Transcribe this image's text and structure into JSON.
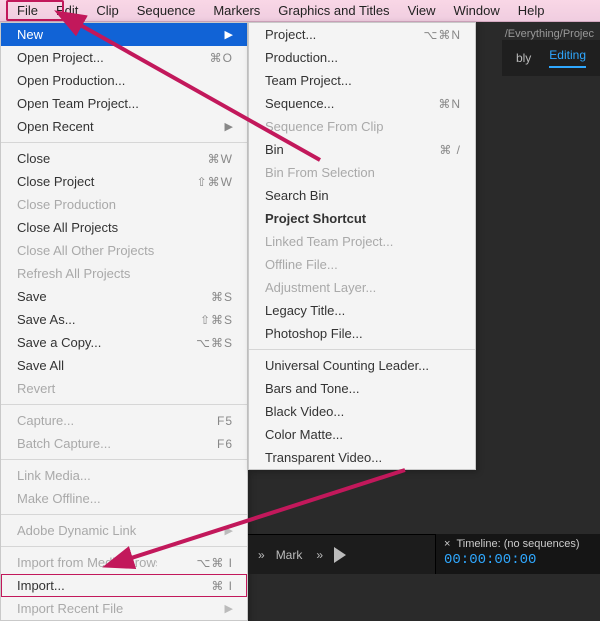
{
  "menubar": {
    "items": [
      "File",
      "Edit",
      "Clip",
      "Sequence",
      "Markers",
      "Graphics and Titles",
      "View",
      "Window",
      "Help"
    ]
  },
  "workspace": {
    "path_fragment": "/Everything/Projec",
    "tab_bly": "bly",
    "tab_editing": "Editing"
  },
  "file_menu": {
    "new": "New",
    "open_project": {
      "label": "Open Project...",
      "shortcut": "⌘O"
    },
    "open_production": "Open Production...",
    "open_team_project": "Open Team Project...",
    "open_recent": "Open Recent",
    "close": {
      "label": "Close",
      "shortcut": "⌘W"
    },
    "close_project": {
      "label": "Close Project",
      "shortcut": "⇧⌘W"
    },
    "close_production": "Close Production",
    "close_all_projects": "Close All Projects",
    "close_all_other": "Close All Other Projects",
    "refresh_all": "Refresh All Projects",
    "save": {
      "label": "Save",
      "shortcut": "⌘S"
    },
    "save_as": {
      "label": "Save As...",
      "shortcut": "⇧⌘S"
    },
    "save_copy": {
      "label": "Save a Copy...",
      "shortcut": "⌥⌘S"
    },
    "save_all": "Save All",
    "revert": "Revert",
    "capture": {
      "label": "Capture...",
      "shortcut": "F5"
    },
    "batch_capture": {
      "label": "Batch Capture...",
      "shortcut": "F6"
    },
    "link_media": "Link Media...",
    "make_offline": "Make Offline...",
    "adl": "Adobe Dynamic Link",
    "import_from_mb": {
      "label": "Import from Media Browser",
      "shortcut": "⌥⌘ I"
    },
    "import": {
      "label": "Import...",
      "shortcut": "⌘ I"
    },
    "import_recent": "Import Recent File"
  },
  "new_submenu": {
    "project": {
      "label": "Project...",
      "shortcut": "⌥⌘N"
    },
    "production": "Production...",
    "team_project": "Team Project...",
    "sequence": {
      "label": "Sequence...",
      "shortcut": "⌘N"
    },
    "sequence_from_clip": "Sequence From Clip",
    "bin": {
      "label": "Bin",
      "shortcut": "⌘ /"
    },
    "bin_from_selection": "Bin From Selection",
    "search_bin": "Search Bin",
    "project_shortcut": "Project Shortcut",
    "linked_team_project": "Linked Team Project...",
    "offline_file": "Offline File...",
    "adjustment_layer": "Adjustment Layer...",
    "legacy_title": "Legacy Title...",
    "photoshop_file": "Photoshop File...",
    "ucl": "Universal Counting Leader...",
    "bars_tone": "Bars and Tone...",
    "black_video": "Black Video...",
    "color_matte": "Color Matte...",
    "transparent_video": "Transparent Video..."
  },
  "bottom": {
    "mark": "Mark",
    "timeline_title": "Timeline: (no sequences)",
    "timecode": "00:00:00:00"
  }
}
